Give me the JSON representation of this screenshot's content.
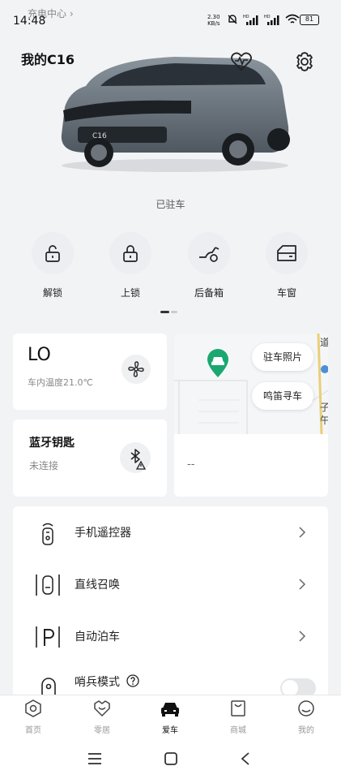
{
  "status_bar": {
    "time": "14:48",
    "back_app": "充电中心 ›",
    "speed_value": "2.30",
    "speed_unit": "KB/s",
    "battery": "81"
  },
  "header": {
    "title": "我的C16",
    "car_plate_text": "C16",
    "state": "已驻车"
  },
  "actions": [
    {
      "label": "解锁",
      "icon": "unlock-icon"
    },
    {
      "label": "上锁",
      "icon": "lock-icon"
    },
    {
      "label": "后备箱",
      "icon": "trunk-icon"
    },
    {
      "label": "车窗",
      "icon": "window-icon"
    }
  ],
  "climate": {
    "value": "LO",
    "subtitle": "车内温度21.0℃"
  },
  "map": {
    "photo_button": "驻车照片",
    "honk_button": "鸣笛寻车",
    "side_text": [
      "道",
      "子",
      "午"
    ]
  },
  "bluetooth": {
    "title": "蓝牙钥匙",
    "status": "未连接"
  },
  "address": {
    "placeholder": "--"
  },
  "features": [
    {
      "label": "手机遥控器",
      "icon": "phone-remote-icon"
    },
    {
      "label": "直线召唤",
      "icon": "straight-summon-icon"
    },
    {
      "label": "自动泊车",
      "icon": "auto-park-icon"
    }
  ],
  "sentinel": {
    "label": "哨兵模式",
    "enabled": false
  },
  "tabs": [
    {
      "label": "首页",
      "icon": "home-icon",
      "active": false
    },
    {
      "label": "零居",
      "icon": "heart-icon",
      "active": false
    },
    {
      "label": "爱车",
      "icon": "car-icon",
      "active": true
    },
    {
      "label": "商城",
      "icon": "shop-icon",
      "active": false
    },
    {
      "label": "我的",
      "icon": "profile-icon",
      "active": false
    }
  ],
  "colors": {
    "accent_green": "#1aa870",
    "background": "#f2f3f5",
    "card": "#ffffff"
  }
}
